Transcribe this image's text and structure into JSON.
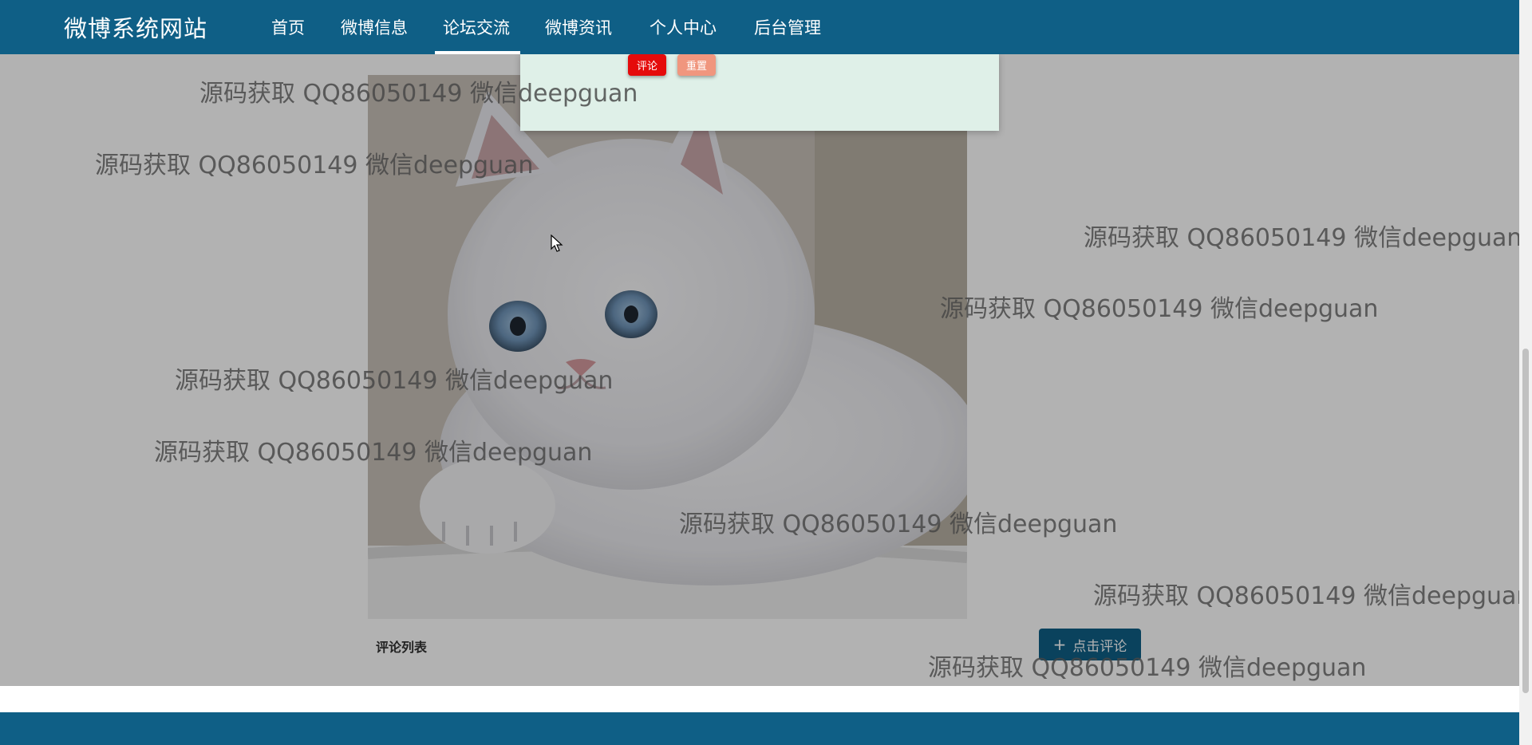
{
  "navbar": {
    "brand": "微博系统网站",
    "items": [
      "首页",
      "微博信息",
      "论坛交流",
      "微博资讯",
      "个人中心",
      "后台管理"
    ],
    "active_index": 2
  },
  "modal": {
    "comment_button": "评论",
    "reset_button": "重置"
  },
  "content": {
    "comment_list_label": "评论列表",
    "click_comment_label": "点击评论",
    "click_comment_icon": "plus-icon"
  },
  "watermark_text": "源码获取 QQ86050149 微信deepguan",
  "colors": {
    "brand": "#0f5f86",
    "comment_button": "#e50b0b",
    "reset_button": "#f0967e",
    "modal_background": "#dff0e8"
  }
}
